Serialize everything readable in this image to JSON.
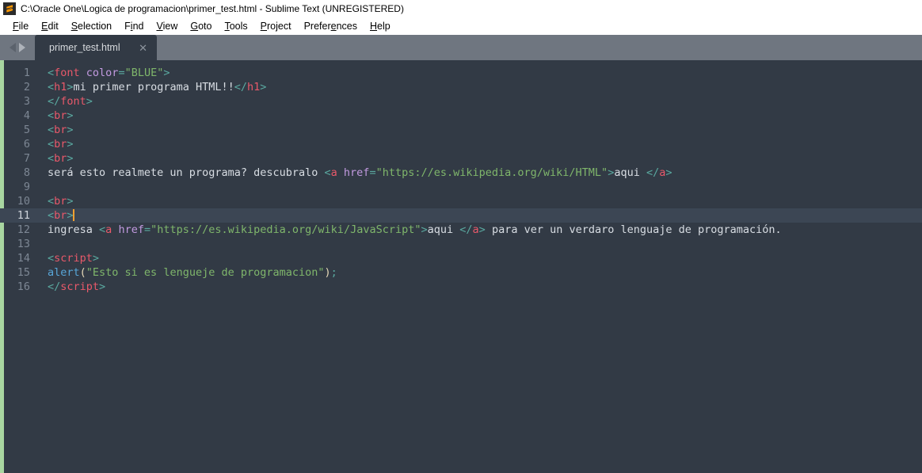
{
  "window": {
    "title": "C:\\Oracle One\\Logica de programacion\\primer_test.html - Sublime Text (UNREGISTERED)",
    "logo_icon": "sublime-text-logo-icon"
  },
  "menubar": {
    "items": [
      {
        "label": "File",
        "accel_index": 0
      },
      {
        "label": "Edit",
        "accel_index": 0
      },
      {
        "label": "Selection",
        "accel_index": 0
      },
      {
        "label": "Find",
        "accel_index": 1
      },
      {
        "label": "View",
        "accel_index": 0
      },
      {
        "label": "Goto",
        "accel_index": 0
      },
      {
        "label": "Tools",
        "accel_index": 0
      },
      {
        "label": "Project",
        "accel_index": 0
      },
      {
        "label": "Preferences",
        "accel_index": 6
      },
      {
        "label": "Help",
        "accel_index": 0
      }
    ]
  },
  "tabbar": {
    "nav_prev_icon": "arrow-left-icon",
    "nav_next_icon": "arrow-right-icon",
    "tabs": [
      {
        "label": "primer_test.html",
        "close_icon": "close-icon",
        "active": true
      }
    ]
  },
  "editor": {
    "active_line": 11,
    "caret_line": 11,
    "caret_column": 5,
    "colors": {
      "background": "#323a45",
      "active_line": "#3c4654",
      "gutter_strip": "#a8d6a0",
      "line_number": "#7d8794",
      "line_number_active": "#ced3da",
      "plain_text": "#d8dde3",
      "punctuation": "#5aa9a0",
      "tag": "#e8596a",
      "attribute": "#c29ae0",
      "string": "#7fb66b",
      "function": "#58a6d8",
      "paren": "#e6d9b8",
      "caret": "#f0a030"
    },
    "lines": [
      {
        "n": 1,
        "tokens": [
          {
            "t": "punct",
            "v": "<"
          },
          {
            "t": "tag",
            "v": "font"
          },
          {
            "t": "text",
            "v": " "
          },
          {
            "t": "attr",
            "v": "color"
          },
          {
            "t": "punct",
            "v": "="
          },
          {
            "t": "string",
            "v": "\"BLUE\""
          },
          {
            "t": "punct",
            "v": ">"
          }
        ]
      },
      {
        "n": 2,
        "tokens": [
          {
            "t": "punct",
            "v": "<"
          },
          {
            "t": "tag",
            "v": "h1"
          },
          {
            "t": "punct",
            "v": ">"
          },
          {
            "t": "text",
            "v": "mi primer programa HTML!!"
          },
          {
            "t": "punct",
            "v": "</"
          },
          {
            "t": "tag",
            "v": "h1"
          },
          {
            "t": "punct",
            "v": ">"
          }
        ]
      },
      {
        "n": 3,
        "tokens": [
          {
            "t": "punct",
            "v": "</"
          },
          {
            "t": "tag",
            "v": "font"
          },
          {
            "t": "punct",
            "v": ">"
          }
        ]
      },
      {
        "n": 4,
        "tokens": [
          {
            "t": "punct",
            "v": "<"
          },
          {
            "t": "tag",
            "v": "br"
          },
          {
            "t": "punct",
            "v": ">"
          }
        ]
      },
      {
        "n": 5,
        "tokens": [
          {
            "t": "punct",
            "v": "<"
          },
          {
            "t": "tag",
            "v": "br"
          },
          {
            "t": "punct",
            "v": ">"
          }
        ]
      },
      {
        "n": 6,
        "tokens": [
          {
            "t": "punct",
            "v": "<"
          },
          {
            "t": "tag",
            "v": "br"
          },
          {
            "t": "punct",
            "v": ">"
          }
        ]
      },
      {
        "n": 7,
        "tokens": [
          {
            "t": "punct",
            "v": "<"
          },
          {
            "t": "tag",
            "v": "br"
          },
          {
            "t": "punct",
            "v": ">"
          }
        ]
      },
      {
        "n": 8,
        "tokens": [
          {
            "t": "text",
            "v": "será esto realmete un programa? descubralo "
          },
          {
            "t": "punct",
            "v": "<"
          },
          {
            "t": "tag",
            "v": "a"
          },
          {
            "t": "text",
            "v": " "
          },
          {
            "t": "attr",
            "v": "href"
          },
          {
            "t": "punct",
            "v": "="
          },
          {
            "t": "string",
            "v": "\"https://es.wikipedia.org/wiki/HTML\""
          },
          {
            "t": "punct",
            "v": ">"
          },
          {
            "t": "text",
            "v": "aqui "
          },
          {
            "t": "punct",
            "v": "</"
          },
          {
            "t": "tag",
            "v": "a"
          },
          {
            "t": "punct",
            "v": ">"
          }
        ]
      },
      {
        "n": 9,
        "tokens": []
      },
      {
        "n": 10,
        "tokens": [
          {
            "t": "punct",
            "v": "<"
          },
          {
            "t": "tag",
            "v": "br"
          },
          {
            "t": "punct",
            "v": ">"
          }
        ]
      },
      {
        "n": 11,
        "tokens": [
          {
            "t": "punct",
            "v": "<"
          },
          {
            "t": "tag",
            "v": "br"
          },
          {
            "t": "punct",
            "v": ">"
          },
          {
            "t": "caret",
            "v": ""
          }
        ]
      },
      {
        "n": 12,
        "tokens": [
          {
            "t": "text",
            "v": "ingresa "
          },
          {
            "t": "punct",
            "v": "<"
          },
          {
            "t": "tag",
            "v": "a"
          },
          {
            "t": "text",
            "v": " "
          },
          {
            "t": "attr",
            "v": "href"
          },
          {
            "t": "punct",
            "v": "="
          },
          {
            "t": "string",
            "v": "\"https://es.wikipedia.org/wiki/JavaScript\""
          },
          {
            "t": "punct",
            "v": ">"
          },
          {
            "t": "text",
            "v": "aqui "
          },
          {
            "t": "punct",
            "v": "</"
          },
          {
            "t": "tag",
            "v": "a"
          },
          {
            "t": "punct",
            "v": ">"
          },
          {
            "t": "text",
            "v": " para ver un verdaro lenguaje de programación."
          }
        ]
      },
      {
        "n": 13,
        "tokens": []
      },
      {
        "n": 14,
        "tokens": [
          {
            "t": "punct",
            "v": "<"
          },
          {
            "t": "tag",
            "v": "script"
          },
          {
            "t": "punct",
            "v": ">"
          }
        ]
      },
      {
        "n": 15,
        "tokens": [
          {
            "t": "func",
            "v": "alert"
          },
          {
            "t": "paren",
            "v": "("
          },
          {
            "t": "string",
            "v": "\"Esto si es lengueje de programacion\""
          },
          {
            "t": "paren",
            "v": ")"
          },
          {
            "t": "semi",
            "v": ";"
          }
        ]
      },
      {
        "n": 16,
        "tokens": [
          {
            "t": "punct",
            "v": "</"
          },
          {
            "t": "tag",
            "v": "script"
          },
          {
            "t": "punct",
            "v": ">"
          }
        ]
      }
    ]
  }
}
